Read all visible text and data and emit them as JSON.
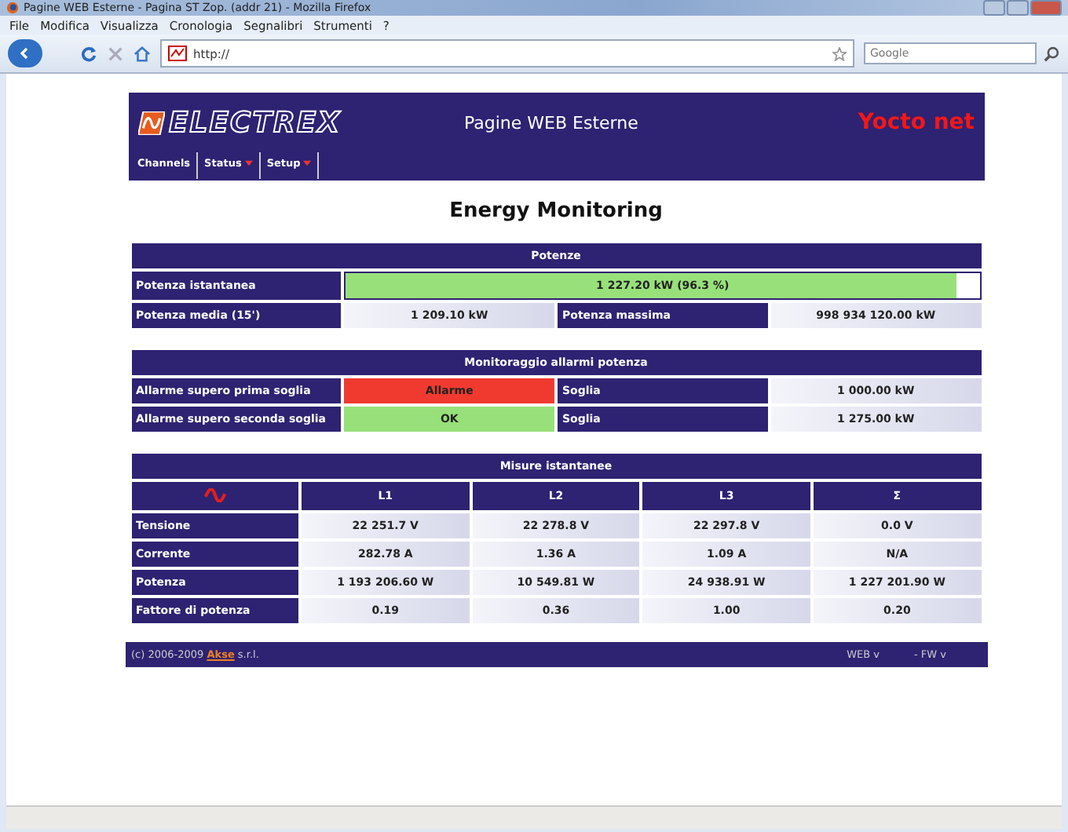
{
  "window": {
    "title": "Pagine WEB Esterne - Pagina ST Zop. (addr 21) - Mozilla Firefox"
  },
  "menu": [
    "File",
    "Modifica",
    "Visualizza",
    "Cronologia",
    "Segnalibri",
    "Strumenti",
    "?"
  ],
  "address": {
    "value": "http://"
  },
  "search": {
    "placeholder": "Google"
  },
  "banner": {
    "logo": "ELECTREX",
    "subtitle": "Pagine WEB Esterne",
    "product": "Yocto net"
  },
  "nav": [
    {
      "label": "Channels",
      "has_menu": false
    },
    {
      "label": "Status",
      "has_menu": true
    },
    {
      "label": "Setup",
      "has_menu": true
    }
  ],
  "heading": "Energy Monitoring",
  "power": {
    "title": "Potenze",
    "instant_label": "Potenza istantanea",
    "instant_value": "1 227.20 kW (96.3 %)",
    "level": 0.963,
    "avg_label": "Potenza media (15')",
    "avg_value": "1 209.10 kW",
    "max_label": "Potenza massima",
    "max_value": "998 934 120.00 kW"
  },
  "alarms": {
    "title": "Monitoraggio allarmi potenza",
    "rows": [
      {
        "label": "Allarme supero prima soglia",
        "status": "Allarme",
        "kind": "alarm",
        "threshold_label": "Soglia",
        "threshold": "1 000.00 kW"
      },
      {
        "label": "Allarme supero seconda soglia",
        "status": "OK",
        "kind": "ok",
        "threshold_label": "Soglia",
        "threshold": "1 275.00 kW"
      }
    ]
  },
  "measures": {
    "title": "Misure istantanee",
    "columns": [
      "L1",
      "L2",
      "L3",
      "Σ"
    ],
    "rows": [
      {
        "label": "Tensione",
        "values": [
          "22 251.7 V",
          "22 278.8 V",
          "22 297.8 V",
          "0.0 V"
        ]
      },
      {
        "label": "Corrente",
        "values": [
          "282.78 A",
          "1.36 A",
          "1.09 A",
          "N/A"
        ]
      },
      {
        "label": "Potenza",
        "values": [
          "1 193 206.60 W",
          "10 549.81 W",
          "24 938.91 W",
          "1 227 201.90 W"
        ]
      },
      {
        "label": "Fattore di potenza",
        "values": [
          "0.19",
          "0.36",
          "1.00",
          "0.20"
        ]
      }
    ]
  },
  "footer": {
    "copyright": "(c) 2006-2009",
    "company_link": "Akse",
    "company_suffix": "s.r.l.",
    "web": "WEB v",
    "fw": "- FW v"
  }
}
